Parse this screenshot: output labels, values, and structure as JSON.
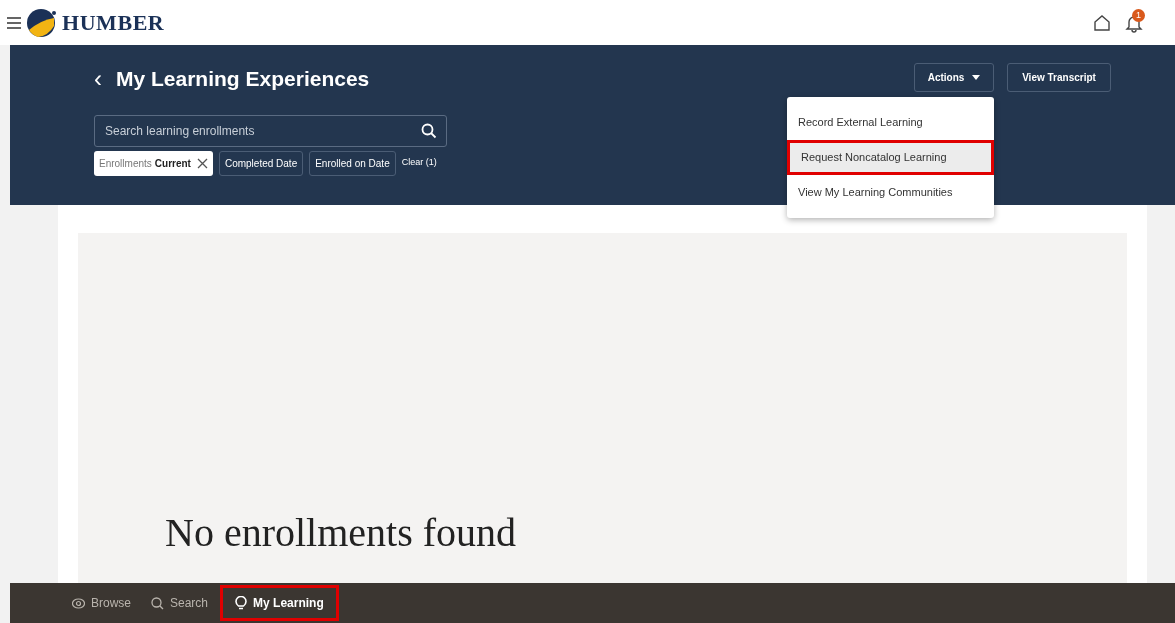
{
  "header": {
    "logo_text": "HUMBER",
    "notification_count": "1"
  },
  "page": {
    "back": "‹",
    "title": "My Learning Experiences"
  },
  "search": {
    "placeholder": "Search learning enrollments"
  },
  "filters": [
    {
      "kind": "applied",
      "label": "Enrollments",
      "value": "Current"
    },
    {
      "kind": "plain",
      "label": "Completed Date"
    },
    {
      "kind": "plain",
      "label": "Enrolled on Date"
    },
    {
      "kind": "clear",
      "label": "Clear (1)"
    }
  ],
  "actions": [
    {
      "kind": "menu",
      "label": "Actions"
    },
    {
      "kind": "plain",
      "label": "View Transcript"
    }
  ],
  "actions_menu": [
    {
      "label": "Record External Learning",
      "highlighted": false
    },
    {
      "label": "Request Noncatalog Learning",
      "highlighted": true
    },
    {
      "label": "View My Learning Communities",
      "highlighted": false
    }
  ],
  "empty_message": "No enrollments found",
  "bottom_nav": [
    {
      "kind": "eye",
      "label": "Browse",
      "selected": false,
      "highlighted": false
    },
    {
      "kind": "search",
      "label": "Search",
      "selected": false,
      "highlighted": false
    },
    {
      "kind": "bulb",
      "label": "My Learning",
      "selected": true,
      "highlighted": true
    }
  ]
}
